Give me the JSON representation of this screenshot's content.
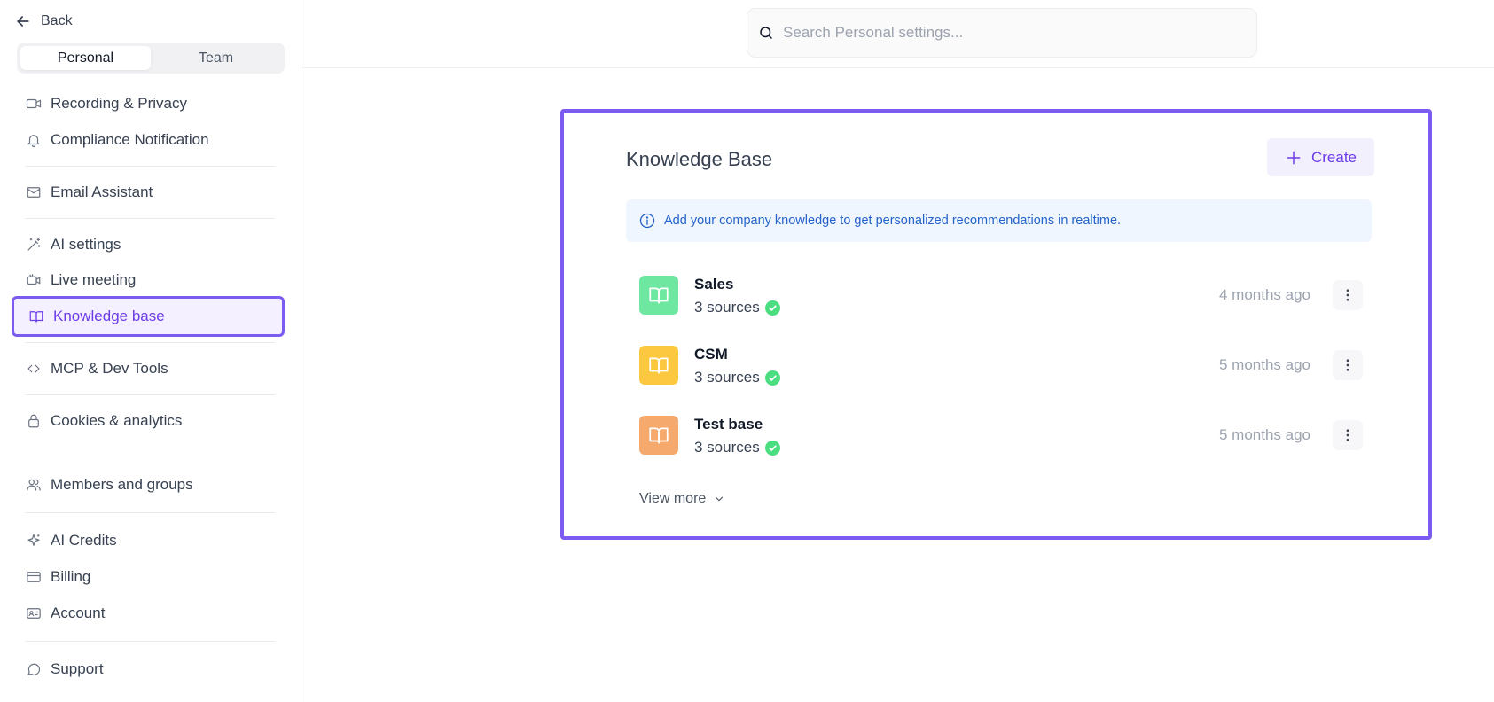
{
  "sidebar": {
    "back_label": "Back",
    "tabs": [
      {
        "label": "Personal",
        "active": true
      },
      {
        "label": "Team",
        "active": false
      }
    ],
    "items": [
      {
        "label": "Recording & Privacy",
        "icon": "video-icon"
      },
      {
        "label": "Compliance Notification",
        "icon": "bell-icon"
      },
      {
        "label": "Email Assistant",
        "icon": "mail-icon"
      },
      {
        "label": "AI settings",
        "icon": "magic-wand-icon"
      },
      {
        "label": "Live meeting",
        "icon": "video-call-icon"
      },
      {
        "label": "Knowledge base",
        "icon": "book-icon",
        "active": true
      },
      {
        "label": "MCP & Dev Tools",
        "icon": "code-icon"
      },
      {
        "label": "Cookies & analytics",
        "icon": "lock-icon"
      },
      {
        "label": "Members and groups",
        "icon": "users-icon"
      },
      {
        "label": "AI Credits",
        "icon": "sparkles-icon"
      },
      {
        "label": "Billing",
        "icon": "credit-card-icon"
      },
      {
        "label": "Account",
        "icon": "id-card-icon"
      },
      {
        "label": "Support",
        "icon": "chat-bubble-icon"
      }
    ]
  },
  "search": {
    "placeholder": "Search Personal settings..."
  },
  "knowledge_base": {
    "title": "Knowledge Base",
    "create_label": "Create",
    "info_text": "Add your company knowledge to get personalized recommendations in realtime.",
    "items": [
      {
        "name": "Sales",
        "sources": "3 sources",
        "time": "4 months ago",
        "color": "#6ee7a0"
      },
      {
        "name": "CSM",
        "sources": "3 sources",
        "time": "5 months ago",
        "color": "#fcc83f"
      },
      {
        "name": "Test base",
        "sources": "3 sources",
        "time": "5 months ago",
        "color": "#f5a96c"
      }
    ],
    "view_more_label": "View more"
  },
  "colors": {
    "accent": "#6d3ce8",
    "highlight_border": "#7c5cf0",
    "info_bg": "#eff6ff",
    "success": "#4ade80"
  }
}
